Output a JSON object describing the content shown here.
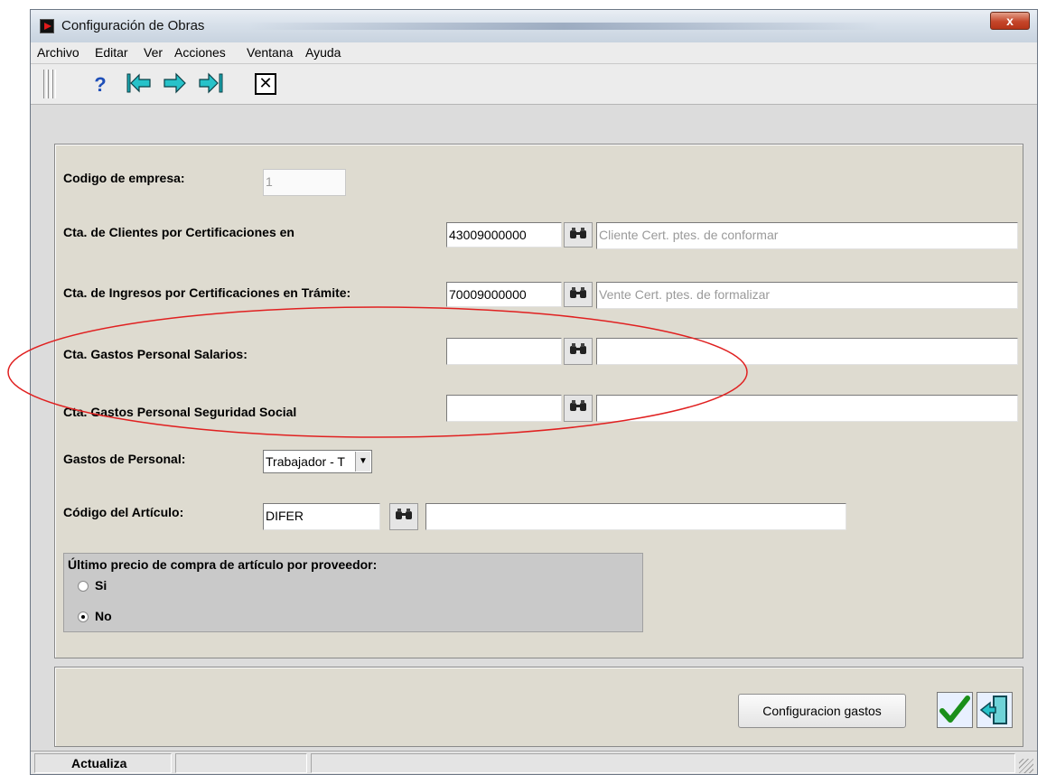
{
  "window": {
    "title": "Configuración de Obras",
    "close_glyph": "x",
    "accent_close": "#c5462a"
  },
  "menu": [
    "Archivo",
    "Editar",
    "Ver",
    "Acciones",
    "Ventana",
    "Ayuda"
  ],
  "toolbar": {
    "icons": [
      "help-icon",
      "first-record-icon",
      "next-record-icon",
      "last-record-icon",
      "close-window-icon"
    ]
  },
  "form": {
    "codigo_empresa": {
      "label": "Codigo de empresa:",
      "value": "1"
    },
    "cta_clientes": {
      "label": "Cta. de Clientes por Certificaciones en",
      "code": "43009000000",
      "description": "Cliente Cert. ptes. de conformar"
    },
    "cta_ingresos": {
      "label": "Cta. de Ingresos por Certificaciones en Trámite:",
      "code": "70009000000",
      "description": "Vente Cert. ptes. de formalizar"
    },
    "cta_salarios": {
      "label": "Cta. Gastos Personal Salarios:",
      "code": "",
      "description": ""
    },
    "cta_seg_social": {
      "label": "Cta. Gastos Personal Seguridad Social",
      "code": "",
      "description": ""
    },
    "gastos_personal": {
      "label": "Gastos de Personal:",
      "selected": "Trabajador - T"
    },
    "codigo_articulo": {
      "label": "Código del Artículo:",
      "code": "DIFER",
      "description": ""
    },
    "ultimo_precio": {
      "legend": "Último precio de compra de artículo por proveedor:",
      "options": [
        {
          "label": "Si",
          "checked": false
        },
        {
          "label": "No",
          "checked": true
        }
      ]
    }
  },
  "bottom": {
    "config_button": "Configuracion gastos",
    "ok_icon": "checkmark-icon",
    "exit_icon": "exit-door-icon"
  },
  "statusbar": {
    "text": "Actualiza"
  },
  "annotation": {
    "color": "#e02020"
  }
}
